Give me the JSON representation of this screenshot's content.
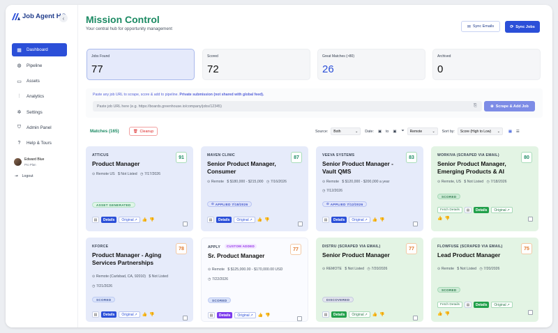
{
  "sidebar": {
    "brand": "Job Agent HQ",
    "collapse_glyph": "‹",
    "items": [
      {
        "label": "Dashboard",
        "icon": "grid-icon",
        "glyph": "▦"
      },
      {
        "label": "Pipeline",
        "icon": "pipeline-icon",
        "glyph": "◍"
      },
      {
        "label": "Assets",
        "icon": "folder-icon",
        "glyph": "▭"
      },
      {
        "label": "Analytics",
        "icon": "chart-icon",
        "glyph": "⫶"
      },
      {
        "label": "Settings",
        "icon": "gear-icon",
        "glyph": "✲"
      },
      {
        "label": "Admin Panel",
        "icon": "shield-icon",
        "glyph": "⛉"
      },
      {
        "label": "Help & Tours",
        "icon": "help-icon",
        "glyph": "?"
      }
    ],
    "user": {
      "name": "Edward Blue",
      "plan": "Pro Plan"
    },
    "logout": "Logout"
  },
  "header": {
    "title": "Mission Control",
    "subtitle": "Your central hub for opportunity management",
    "sync_emails": "Sync Emails",
    "sync_jobs": "Sync Jobs"
  },
  "stats": [
    {
      "label": "Jobs Found",
      "value": "77"
    },
    {
      "label": "Scored",
      "value": "72"
    },
    {
      "label": "Great Matches (>80)",
      "value": "26"
    },
    {
      "label": "Archived",
      "value": "0"
    }
  ],
  "paste": {
    "hint_main": "Paste any job URL to scrape, score & add to pipeline. ",
    "hint_bold": "Private submission (not shared with global feed).",
    "placeholder": "Paste job URL here (e.g. https://boards.greenhouse.io/company/jobs/12345)",
    "scrape_button": "Scrape & Add Job"
  },
  "matches": {
    "label": "Matches (165)",
    "cleanup": "Cleanup"
  },
  "filters": {
    "source_label": "Source:",
    "source_value": "Both",
    "date_label": "Date:",
    "date_to": "to",
    "filter_value": "Remote",
    "sort_label": "Sort by:",
    "sort_value": "Score (High to Low)"
  },
  "colors": {
    "accent": "#2b4fd8",
    "brand_green": "#1c8a63",
    "card_blue": "#e6ebfa",
    "card_green": "#e3f4e4"
  },
  "cards": [
    {
      "company": "ATTICUS",
      "title": "Product Manager",
      "score": "91",
      "location": "Remote US",
      "salary": "Not Listed",
      "date": "7/17/2026",
      "status": "ASSET GENERATED"
    },
    {
      "company": "MAVEN CLINIC",
      "title": "Senior Product Manager, Consumer",
      "score": "87",
      "location": "Remote",
      "salary": "$180,000 - $215,000",
      "date": "7/16/2026",
      "status": "APPLIED 7/18/2026"
    },
    {
      "company": "VEEVA SYSTEMS",
      "title": "Senior Product Manager - Vault QMS",
      "score": "83",
      "location": "Remote",
      "salary": "$120,000 - $200,000 a year",
      "date": "7/12/2026",
      "status": "APPLIED 7/12/2026"
    },
    {
      "company": "WORKIVA (SCRAPED VIA EMAIL)",
      "title": "Senior Product Manager, Emerging Products & AI",
      "score": "80",
      "location": "Remote, US",
      "salary": "Not Listed",
      "date": "7/18/2026",
      "status": "SCORED"
    },
    {
      "company": "KFORCE",
      "title": "Product Manager - Aging Services Partnerships",
      "score": "78",
      "location": "Remote (Carlsbad, CA, 92010)",
      "salary": "Not Listed",
      "date": "7/21/2026",
      "status": "SCORED"
    },
    {
      "company": "APPLY",
      "custom": "CUSTOM ADDED",
      "title": "Sr. Product Manager",
      "score": "77",
      "location": "Remote",
      "salary": "$125,000.00 - $170,000.00 USD",
      "date": "7/22/2026",
      "status": "SCORED"
    },
    {
      "company": "DISTRU (SCRAPED VIA EMAIL)",
      "title": "Senior Product Manager",
      "score": "77",
      "location": "REMOTE",
      "salary": "Not Listed",
      "date": "7/20/2026",
      "status": "DISCOVERED"
    },
    {
      "company": "FLOWFUSE (SCRAPED VIA EMAIL)",
      "title": "Lead Product Manager",
      "score": "75",
      "location": "Remote",
      "salary": "Not Listed",
      "date": "7/20/2026",
      "status": "SCORED"
    }
  ],
  "card_actions": {
    "details": "Details",
    "original": "Original",
    "fetch_details": "Fetch Details"
  }
}
